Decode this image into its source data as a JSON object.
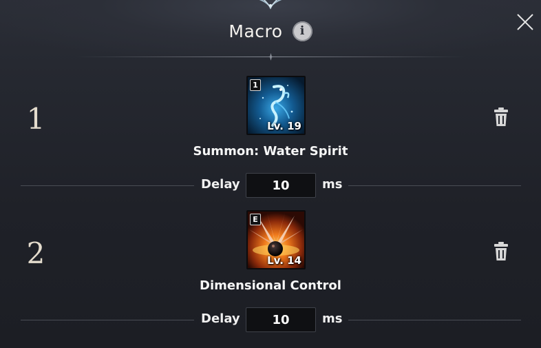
{
  "window": {
    "title": "Macro",
    "info_glyph": "i"
  },
  "entries": [
    {
      "number": "1",
      "key": "1",
      "level": "Lv. 19",
      "skill_name": "Summon: Water Spirit",
      "delay_label": "Delay",
      "delay_value": "10",
      "unit": "ms",
      "icon": "water-spirit-icon"
    },
    {
      "number": "2",
      "key": "E",
      "level": "Lv. 14",
      "skill_name": "Dimensional Control",
      "delay_label": "Delay",
      "delay_value": "10",
      "unit": "ms",
      "icon": "dimensional-control-icon"
    }
  ],
  "icons": {
    "info": "info-icon",
    "close": "close-icon",
    "delete": "trash-icon"
  },
  "colors": {
    "panel_bg": "#22252c",
    "number": "#e4dccd",
    "input_bg": "#0f1013",
    "divider": "#4a4d55"
  }
}
